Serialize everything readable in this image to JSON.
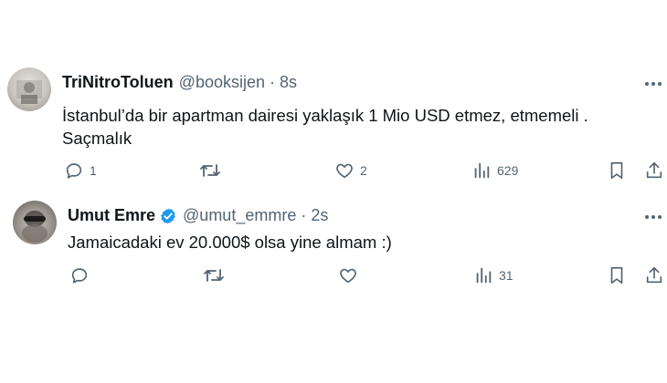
{
  "tweets": [
    {
      "author_name": "TriNitroToluen",
      "handle": "@booksijen",
      "separator": "·",
      "time": "8s",
      "verified": false,
      "text_line1": "İstanbul’da bir apartman dairesi yaklaşık 1 Mio USD etmez, etmemeli .",
      "text_line2": "Saçmalık",
      "replies": "1",
      "retweets": "",
      "likes": "2",
      "views": "629"
    },
    {
      "author_name": "Umut Emre",
      "handle": "@umut_emmre",
      "separator": "·",
      "time": "2s",
      "verified": true,
      "text_line1": "Jamaicadaki ev 20.000$ olsa yine almam :)",
      "replies": "",
      "retweets": "",
      "likes": "",
      "views": "31"
    }
  ],
  "icons": {
    "reply": "reply-icon",
    "retweet": "retweet-icon",
    "like": "heart-icon",
    "views": "views-icon",
    "bookmark": "bookmark-icon",
    "share": "share-icon",
    "more": "more-icon",
    "verified": "verified-badge-icon"
  },
  "colors": {
    "text_primary": "#0f1419",
    "text_secondary": "#536471",
    "verified_blue": "#1d9bf0"
  }
}
